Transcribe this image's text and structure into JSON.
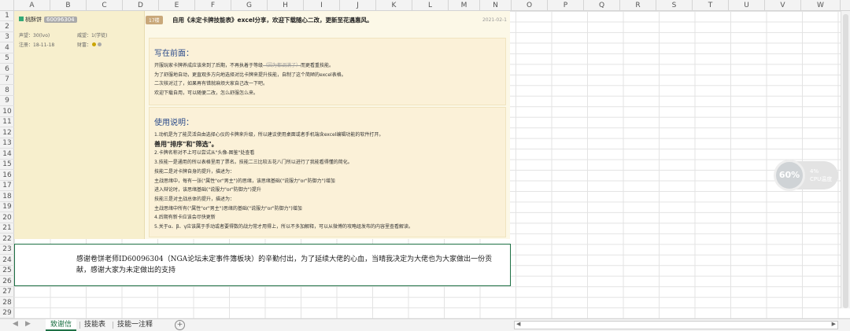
{
  "columns": [
    "A",
    "B",
    "C",
    "D",
    "E",
    "F",
    "G",
    "H",
    "I",
    "J",
    "K",
    "L",
    "M",
    "N",
    "O",
    "P",
    "Q",
    "R",
    "S",
    "T",
    "U",
    "V",
    "W"
  ],
  "rows": [
    "1",
    "2",
    "3",
    "4",
    "5",
    "6",
    "7",
    "8",
    "9",
    "10",
    "11",
    "12",
    "13",
    "14",
    "15",
    "16",
    "17",
    "18",
    "19",
    "20",
    "21",
    "22",
    "23",
    "24",
    "25",
    "26",
    "27",
    "28",
    "29"
  ],
  "post": {
    "username": "桃酥饼",
    "uid_badge": "60096304",
    "reputation": "声望：30(lvo)",
    "prestige": "威望：1(学徒)",
    "register": "注册：18-11-18",
    "wealth": "财富：",
    "tag": "17楼",
    "title": "自用《未定卡牌技能表》excel分享，欢迎下载随心二改，更新至花遇惠风。",
    "date": "2021-02-1",
    "preface": {
      "heading": "写在前面：",
      "lines": [
        "开服玩家卡牌养成应该来到了后期，不再执着于等级",
        "（因为都调满了）",
        "而更看重技能。",
        "为了舒服地自动，更直观多方向地选择对比卡牌来提升技能，自制了这个简陋的excel表格。",
        "二次核对过了，如果再有错就麻烦大家自己改一下吧。",
        "欢迎下载自用，可以随便二改，怎么舒服怎么来。"
      ]
    },
    "usage": {
      "heading": "使用说明：",
      "lines": [
        "1.动机是为了能灵活自由选择心仪的卡牌来升级，所以建议使用桌面或者手机端含excel编辑功能的软件打开。",
        "善用\"排序\"和\"筛选\"。",
        "2.卡牌名称对不上可以尝试从\"头像-图鉴\"处查看",
        "3.技能一是通用的所以表格里用了票名。技能二三比较五花八门所以进行了我能看得懂的简化。",
        "技能二是对卡牌自身的提升，描述为：",
        "主战思绪中，每有一张(\"属性\"or\"男主\")的思绪，该思绪基础(\"说服力\"or\"防御力\")增加",
        "进入辩论时，该思绪基础(\"说服力\"or\"防御力\")提升",
        "技能三是对主战总体的提升，描述为：",
        "主战思绪中所有(\"属性\"or\"男主\")思绪的基础(\"说服力\"or\"防御力\")增加",
        "4.后期有新卡应该会尽快更新",
        "5.关于α、β、γ应该属于手动或者要得数的战力常才用得上，所以不多加解释，可以从微博的攻略组发布的内容里查看解读。"
      ]
    }
  },
  "note": {
    "text": "感谢卷饼老师ID60096304（NGA论坛未定事件簿板块）的辛勤付出，为了延续大佬的心血，当晴我决定为大佬也为大家做出一份贡献，感谢大家为未定做出的支持"
  },
  "cpu": {
    "percent": "60%",
    "temp": "4%",
    "label": "CPU温度"
  },
  "sheets": {
    "tab1": "致谢信",
    "tab2": "技能表",
    "tab3": "技能一注释",
    "add": "+"
  },
  "colors": {
    "accent": "#1e7145",
    "post_bg": "#fcf8e7",
    "header_blue": "#2a4a8a"
  }
}
